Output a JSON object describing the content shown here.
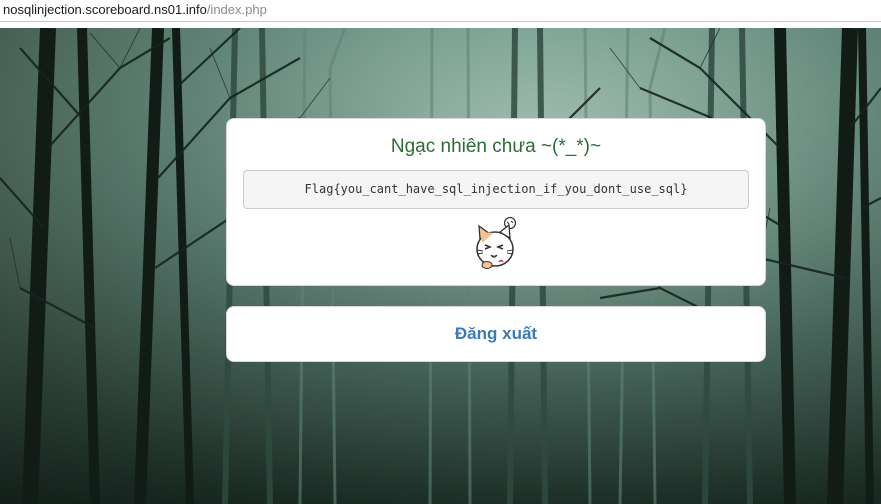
{
  "browser": {
    "url_host": "nosqlinjection.scoreboard.ns01.info",
    "url_path": "/index.php"
  },
  "result_card": {
    "heading": "Ngạc nhiên chưa ~(*_*)~",
    "flag_text": "Flag{you_cant_have_sql_injection_if_you_dont_use_sql}",
    "image_icon": "surprised-cat-icon"
  },
  "logout_card": {
    "logout_label": "Đăng xuất"
  },
  "colors": {
    "heading": "#2e6b36",
    "link": "#3a7ab8",
    "flag_bg": "#f5f5f5",
    "background_fog": "#7fa597"
  }
}
